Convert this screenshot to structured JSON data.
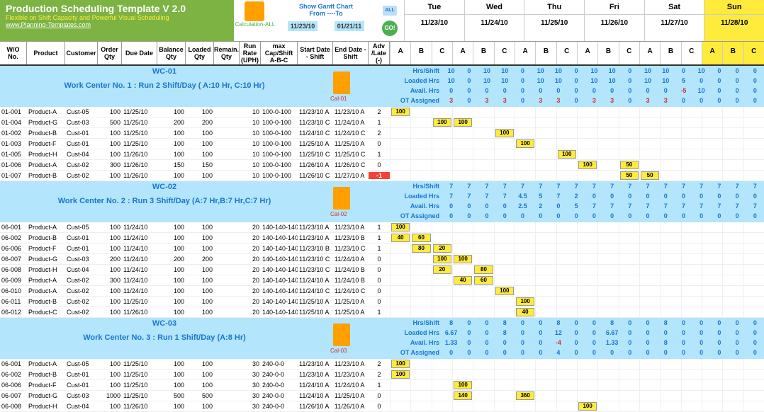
{
  "header": {
    "title": "Production Scheduling Template V 2.0",
    "subtitle": "Flexible on Shift Capacity and Powerful Visual Scheduling",
    "link": "www.Planning-Templates.com",
    "calc_label": "Calculation-ALL",
    "gantt_label": "Show Gantt Chart",
    "from_to": "From ----To",
    "date_from": "11/23/10",
    "date_to": "01/21/11",
    "all": "ALL",
    "go": "GO!"
  },
  "days": [
    {
      "name": "Tue",
      "date": "11/23/10",
      "sun": false
    },
    {
      "name": "Wed",
      "date": "11/24/10",
      "sun": false
    },
    {
      "name": "Thu",
      "date": "11/25/10",
      "sun": false
    },
    {
      "name": "Fri",
      "date": "11/26/10",
      "sun": false
    },
    {
      "name": "Sat",
      "date": "11/27/10",
      "sun": false
    },
    {
      "name": "Sun",
      "date": "11/28/10",
      "sun": true
    }
  ],
  "cols": {
    "wo": "W/O No.",
    "prod": "Product",
    "cust": "Customer",
    "oqty": "Order Qty",
    "due": "Due Date",
    "bal": "Balance Qty",
    "load": "Loaded Qty",
    "rem": "Remain. Qty",
    "rate": "Run Rate (UPH)",
    "cap": "max Cap/Shift A-B-C",
    "start": "Start Date - Shift",
    "end": "End Date - Shift",
    "adv": "Adv /Late (-)"
  },
  "abc": [
    "A",
    "B",
    "C"
  ],
  "stat_labels": [
    "Hrs/Shift",
    "Loaded Hrs",
    "Avail. Hrs",
    "OT Assigned"
  ],
  "wcs": [
    {
      "title": "WC-01",
      "desc": "Work Center No. 1 : Run 2 Shift/Day ( A:10 Hr, C:10 Hr)",
      "cal": "Cal-01",
      "stats": [
        [
          "10",
          "0",
          "10",
          "10",
          "0",
          "10",
          "10",
          "0",
          "10",
          "10",
          "0",
          "10",
          "10",
          "0",
          "10",
          "0",
          "0",
          "0"
        ],
        [
          "10",
          "0",
          "10",
          "10",
          "0",
          "10",
          "10",
          "0",
          "10",
          "10",
          "0",
          "10",
          "10",
          "5",
          "0",
          "0",
          "0",
          "0"
        ],
        [
          "0",
          "0",
          "0",
          "0",
          "0",
          "0",
          "0",
          "0",
          "0",
          "0",
          "0",
          "0",
          "0",
          "-5",
          "10",
          "0",
          "0",
          "0"
        ],
        [
          "3",
          "0",
          "3",
          "3",
          "0",
          "3",
          "3",
          "0",
          "3",
          "3",
          "0",
          "3",
          "3",
          "0",
          "0",
          "0",
          "0",
          "0"
        ]
      ],
      "rows": [
        {
          "wo": "01-001",
          "prod": "Product-A",
          "cust": "Cust-05",
          "oqty": "100",
          "due": "11/25/10",
          "bal": "100",
          "load": "100",
          "rem": "",
          "rate": "10",
          "cap": "100-0-100",
          "start": "11/23/10 A",
          "end": "11/23/10 A",
          "adv": "2",
          "bars": [
            {
              "col": 0,
              "v": "100"
            }
          ]
        },
        {
          "wo": "01-004",
          "prod": "Product-G",
          "cust": "Cust-03",
          "oqty": "500",
          "due": "11/25/10",
          "bal": "200",
          "load": "200",
          "rem": "",
          "rate": "10",
          "cap": "100-0-100",
          "start": "11/23/10 C",
          "end": "11/24/10 A",
          "adv": "1",
          "bars": [
            {
              "col": 2,
              "v": "100"
            },
            {
              "col": 3,
              "v": "100"
            }
          ]
        },
        {
          "wo": "01-002",
          "prod": "Product-B",
          "cust": "Cust-01",
          "oqty": "100",
          "due": "11/25/10",
          "bal": "100",
          "load": "100",
          "rem": "",
          "rate": "10",
          "cap": "100-0-100",
          "start": "11/24/10 C",
          "end": "11/24/10 C",
          "adv": "2",
          "bars": [
            {
              "col": 5,
              "v": "100"
            }
          ]
        },
        {
          "wo": "01-003",
          "prod": "Product-F",
          "cust": "Cust-01",
          "oqty": "100",
          "due": "11/25/10",
          "bal": "100",
          "load": "100",
          "rem": "",
          "rate": "10",
          "cap": "100-0-100",
          "start": "11/25/10 A",
          "end": "11/25/10 A",
          "adv": "0",
          "bars": [
            {
              "col": 6,
              "v": "100"
            }
          ]
        },
        {
          "wo": "01-005",
          "prod": "Product-H",
          "cust": "Cust-04",
          "oqty": "100",
          "due": "11/26/10",
          "bal": "100",
          "load": "100",
          "rem": "",
          "rate": "10",
          "cap": "100-0-100",
          "start": "11/25/10 C",
          "end": "11/25/10 C",
          "adv": "1",
          "bars": [
            {
              "col": 8,
              "v": "100"
            }
          ]
        },
        {
          "wo": "01-006",
          "prod": "Product-A",
          "cust": "Cust-02",
          "oqty": "300",
          "due": "11/26/10",
          "bal": "150",
          "load": "150",
          "rem": "",
          "rate": "10",
          "cap": "100-0-100",
          "start": "11/26/10 A",
          "end": "11/26/10 C",
          "adv": "0",
          "bars": [
            {
              "col": 9,
              "v": "100"
            },
            {
              "col": 11,
              "v": "50"
            }
          ]
        },
        {
          "wo": "01-007",
          "prod": "Product-B",
          "cust": "Cust-02",
          "oqty": "100",
          "due": "11/26/10",
          "bal": "100",
          "load": "100",
          "rem": "",
          "rate": "10",
          "cap": "100-0-100",
          "start": "11/26/10 C",
          "end": "11/27/10 A",
          "adv": "-1",
          "bars": [
            {
              "col": 11,
              "v": "50"
            },
            {
              "col": 12,
              "v": "50"
            }
          ]
        }
      ]
    },
    {
      "title": "WC-02",
      "desc": "Work Center No. 2 : Run 3 Shift/Day (A:7 Hr,B:7 Hr,C:7 Hr)",
      "cal": "Cal-02",
      "stats": [
        [
          "7",
          "7",
          "7",
          "7",
          "7",
          "7",
          "7",
          "7",
          "7",
          "7",
          "7",
          "7",
          "7",
          "7",
          "7",
          "7",
          "7",
          "7"
        ],
        [
          "7",
          "7",
          "7",
          "7",
          "4.5",
          "5",
          "7",
          "2",
          "0",
          "0",
          "0",
          "0",
          "0",
          "0",
          "0",
          "0",
          "0",
          "0"
        ],
        [
          "0",
          "0",
          "0",
          "0",
          "2.5",
          "2",
          "0",
          "5",
          "7",
          "7",
          "7",
          "7",
          "7",
          "7",
          "7",
          "7",
          "7",
          "7"
        ],
        [
          "0",
          "0",
          "0",
          "0",
          "0",
          "0",
          "0",
          "0",
          "0",
          "0",
          "0",
          "0",
          "0",
          "0",
          "0",
          "0",
          "0",
          "0"
        ]
      ],
      "rows": [
        {
          "wo": "06-001",
          "prod": "Product-A",
          "cust": "Cust-05",
          "oqty": "100",
          "due": "11/24/10",
          "bal": "100",
          "load": "100",
          "rem": "",
          "rate": "20",
          "cap": "140-140-140",
          "start": "11/23/10 A",
          "end": "11/23/10 A",
          "adv": "1",
          "bars": [
            {
              "col": 0,
              "v": "100"
            }
          ]
        },
        {
          "wo": "06-002",
          "prod": "Product-B",
          "cust": "Cust-01",
          "oqty": "100",
          "due": "11/24/10",
          "bal": "100",
          "load": "100",
          "rem": "",
          "rate": "20",
          "cap": "140-140-140",
          "start": "11/23/10 A",
          "end": "11/23/10 B",
          "adv": "1",
          "bars": [
            {
              "col": 0,
              "v": "40"
            },
            {
              "col": 1,
              "v": "60"
            }
          ]
        },
        {
          "wo": "06-006",
          "prod": "Product-F",
          "cust": "Cust-01",
          "oqty": "100",
          "due": "11/24/10",
          "bal": "100",
          "load": "100",
          "rem": "",
          "rate": "20",
          "cap": "140-140-140",
          "start": "11/23/10 B",
          "end": "11/23/10 C",
          "adv": "1",
          "bars": [
            {
              "col": 1,
              "v": "80"
            },
            {
              "col": 2,
              "v": "20"
            }
          ]
        },
        {
          "wo": "06-007",
          "prod": "Product-G",
          "cust": "Cust-03",
          "oqty": "200",
          "due": "11/24/10",
          "bal": "200",
          "load": "200",
          "rem": "",
          "rate": "20",
          "cap": "140-140-140",
          "start": "11/23/10 C",
          "end": "11/24/10 A",
          "adv": "0",
          "bars": [
            {
              "col": 2,
              "v": "100"
            },
            {
              "col": 3,
              "v": "100"
            }
          ]
        },
        {
          "wo": "06-008",
          "prod": "Product-H",
          "cust": "Cust-04",
          "oqty": "100",
          "due": "11/24/10",
          "bal": "100",
          "load": "100",
          "rem": "",
          "rate": "20",
          "cap": "140-140-140",
          "start": "11/23/10 C",
          "end": "11/24/10 B",
          "adv": "0",
          "bars": [
            {
              "col": 2,
              "v": "20"
            },
            {
              "col": 4,
              "v": "80"
            }
          ]
        },
        {
          "wo": "06-009",
          "prod": "Product-A",
          "cust": "Cust-02",
          "oqty": "300",
          "due": "11/24/10",
          "bal": "100",
          "load": "100",
          "rem": "",
          "rate": "20",
          "cap": "140-140-140",
          "start": "11/24/10 A",
          "end": "11/24/10 B",
          "adv": "0",
          "bars": [
            {
              "col": 3,
              "v": "40"
            },
            {
              "col": 4,
              "v": "60"
            }
          ]
        },
        {
          "wo": "06-010",
          "prod": "Product-A",
          "cust": "Cust-02",
          "oqty": "100",
          "due": "11/24/10",
          "bal": "100",
          "load": "100",
          "rem": "",
          "rate": "20",
          "cap": "140-140-140",
          "start": "11/24/10 C",
          "end": "11/24/10 C",
          "adv": "0",
          "bars": [
            {
              "col": 5,
              "v": "100"
            }
          ]
        },
        {
          "wo": "06-011",
          "prod": "Product-B",
          "cust": "Cust-02",
          "oqty": "100",
          "due": "11/25/10",
          "bal": "100",
          "load": "100",
          "rem": "",
          "rate": "20",
          "cap": "140-140-140",
          "start": "11/25/10 A",
          "end": "11/25/10 A",
          "adv": "0",
          "bars": [
            {
              "col": 6,
              "v": "100"
            }
          ]
        },
        {
          "wo": "06-012",
          "prod": "Product-C",
          "cust": "Cust-02",
          "oqty": "100",
          "due": "11/26/10",
          "bal": "100",
          "load": "100",
          "rem": "",
          "rate": "20",
          "cap": "140-140-140",
          "start": "11/25/10 A",
          "end": "11/25/10 A",
          "adv": "1",
          "bars": [
            {
              "col": 6,
              "v": "40"
            }
          ]
        }
      ]
    },
    {
      "title": "WC-03",
      "desc": "Work Center No. 3 : Run 1 Shift/Day (A:8 Hr)",
      "cal": "Cal-03",
      "stats": [
        [
          "8",
          "0",
          "0",
          "8",
          "0",
          "0",
          "8",
          "0",
          "0",
          "8",
          "0",
          "0",
          "8",
          "0",
          "0",
          "0",
          "0",
          "0"
        ],
        [
          "6.67",
          "0",
          "0",
          "8",
          "0",
          "0",
          "12",
          "0",
          "0",
          "6.67",
          "0",
          "0",
          "0",
          "0",
          "0",
          "0",
          "0",
          "0"
        ],
        [
          "1.33",
          "0",
          "0",
          "0",
          "0",
          "0",
          "-4",
          "0",
          "0",
          "1.33",
          "0",
          "0",
          "8",
          "0",
          "0",
          "0",
          "0",
          "0"
        ],
        [
          "0",
          "0",
          "0",
          "0",
          "0",
          "0",
          "4",
          "0",
          "0",
          "0",
          "0",
          "0",
          "0",
          "0",
          "0",
          "0",
          "0",
          "0"
        ]
      ],
      "rows": [
        {
          "wo": "06-001",
          "prod": "Product-A",
          "cust": "Cust-05",
          "oqty": "100",
          "due": "11/25/10",
          "bal": "100",
          "load": "100",
          "rem": "",
          "rate": "30",
          "cap": "240-0-0",
          "start": "11/23/10 A",
          "end": "11/23/10 A",
          "adv": "2",
          "bars": [
            {
              "col": 0,
              "v": "100"
            }
          ]
        },
        {
          "wo": "06-002",
          "prod": "Product-B",
          "cust": "Cust-01",
          "oqty": "100",
          "due": "11/25/10",
          "bal": "100",
          "load": "100",
          "rem": "",
          "rate": "30",
          "cap": "240-0-0",
          "start": "11/23/10 A",
          "end": "11/23/10 A",
          "adv": "2",
          "bars": [
            {
              "col": 0,
              "v": "100"
            }
          ]
        },
        {
          "wo": "06-006",
          "prod": "Product-F",
          "cust": "Cust-01",
          "oqty": "100",
          "due": "11/25/10",
          "bal": "100",
          "load": "100",
          "rem": "",
          "rate": "30",
          "cap": "240-0-0",
          "start": "11/24/10 A",
          "end": "11/24/10 A",
          "adv": "1",
          "bars": [
            {
              "col": 3,
              "v": "100"
            }
          ]
        },
        {
          "wo": "06-007",
          "prod": "Product-G",
          "cust": "Cust-03",
          "oqty": "1000",
          "due": "11/25/10",
          "bal": "500",
          "load": "500",
          "rem": "",
          "rate": "30",
          "cap": "240-0-0",
          "start": "11/24/10 A",
          "end": "11/25/10 A",
          "adv": "0",
          "bars": [
            {
              "col": 3,
              "v": "140"
            },
            {
              "col": 6,
              "v": "360"
            }
          ]
        },
        {
          "wo": "06-008",
          "prod": "Product-H",
          "cust": "Cust-04",
          "oqty": "100",
          "due": "11/26/10",
          "bal": "100",
          "load": "100",
          "rem": "",
          "rate": "30",
          "cap": "240-0-0",
          "start": "11/26/10 A",
          "end": "11/26/10 A",
          "adv": "0",
          "bars": [
            {
              "col": 9,
              "v": "100"
            }
          ]
        }
      ]
    }
  ]
}
